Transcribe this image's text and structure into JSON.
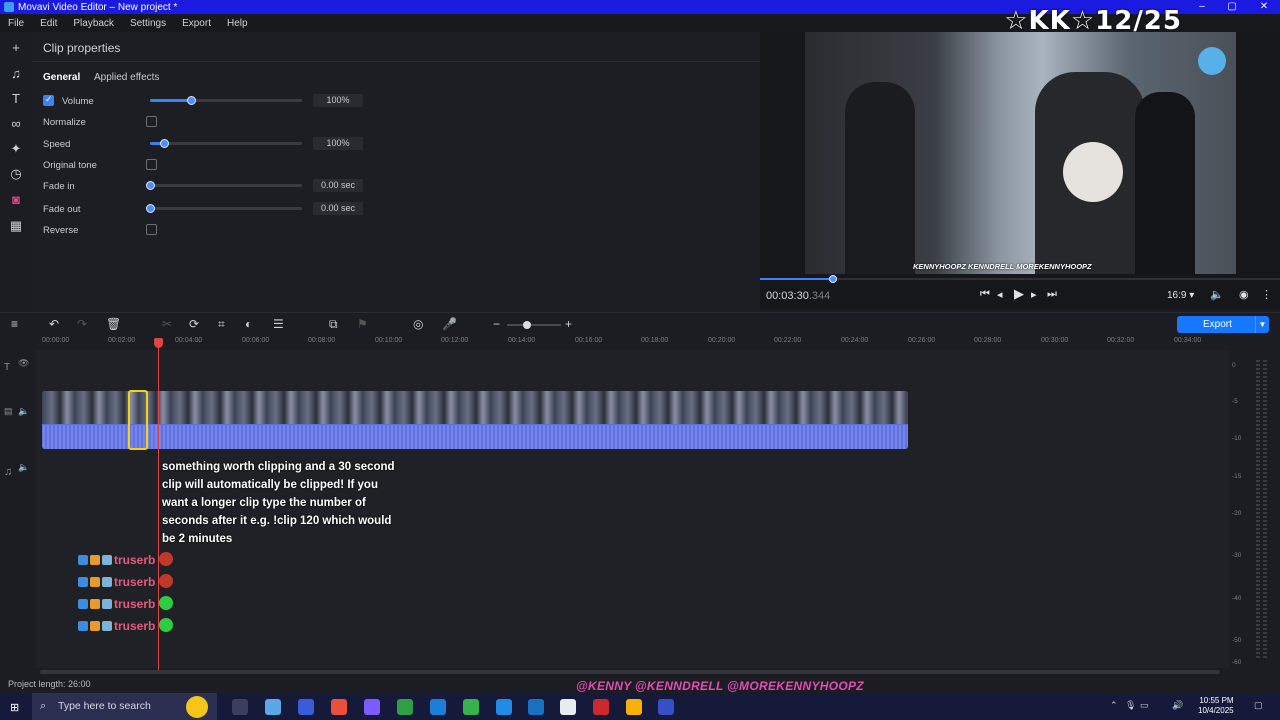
{
  "window": {
    "title": "Movavi Video Editor – New project *",
    "minimize": "–",
    "maximize": "▢",
    "close": "✕"
  },
  "overlay": {
    "title": "☆KK☆12/25"
  },
  "menu": [
    "File",
    "Edit",
    "Playback",
    "Settings",
    "Export",
    "Help"
  ],
  "clip_properties": {
    "heading": "Clip properties",
    "tabs": [
      "General",
      "Applied effects"
    ],
    "volume": {
      "label": "Volume",
      "checked": true,
      "value": "100%",
      "level": 0.27
    },
    "normalize": {
      "label": "Normalize",
      "checked": false
    },
    "speed": {
      "label": "Speed",
      "value": "100%",
      "level": 0.09
    },
    "original_tone": {
      "label": "Original tone",
      "checked": false
    },
    "fade_in": {
      "label": "Fade in",
      "value": "0.00 sec",
      "level": 0
    },
    "fade_out": {
      "label": "Fade out",
      "value": "0.00 sec",
      "level": 0
    },
    "reverse": {
      "label": "Reverse",
      "checked": false
    }
  },
  "player": {
    "timecode": "00:03:30",
    "timecode_ms": ".344",
    "aspect": "16:9",
    "progress": 0.14,
    "video_socials": "KENNYHOOPZ  KENNDRELL  MOREKENNYHOOPZ"
  },
  "toolbar": {
    "export_label": "Export"
  },
  "ruler": [
    "00:00:00",
    "00:02:00",
    "00:04:00",
    "00:06:00",
    "00:08:00",
    "00:10:00",
    "00:12:00",
    "00:14:00",
    "00:16:00",
    "00:18:00",
    "00:20:00",
    "00:22:00",
    "00:24:00",
    "00:26:00",
    "00:28:00",
    "00:30:00",
    "00:32:00",
    "00:34:00"
  ],
  "meter_scale": [
    "0",
    "-5",
    "-10",
    "-15",
    "-20",
    "-30",
    "-40",
    "-50",
    "-60"
  ],
  "chat": {
    "message": "something worth clipping and a 30 second clip will automatically be clipped! If you want a longer clip type the number of seconds after it e.g. !clip 120 which would be 2 minutes",
    "users": [
      "truserb",
      "truserb",
      "truserb",
      "truserb"
    ]
  },
  "status": {
    "project_length": "Project length: 26:00"
  },
  "socialbar": "@KENNY  @KENNDRELL  @MOREKENNYHOOPZ",
  "taskbar": {
    "search_placeholder": "Type here to search",
    "time": "10:55 PM",
    "date": "10/4/2025"
  },
  "colors": {
    "accent": "#1677ff",
    "titlebar": "#1a1ae0",
    "track": "#5b6fe0",
    "playhead": "#e04444",
    "selection": "#f2d21a",
    "chat_user": "#e8587a"
  }
}
